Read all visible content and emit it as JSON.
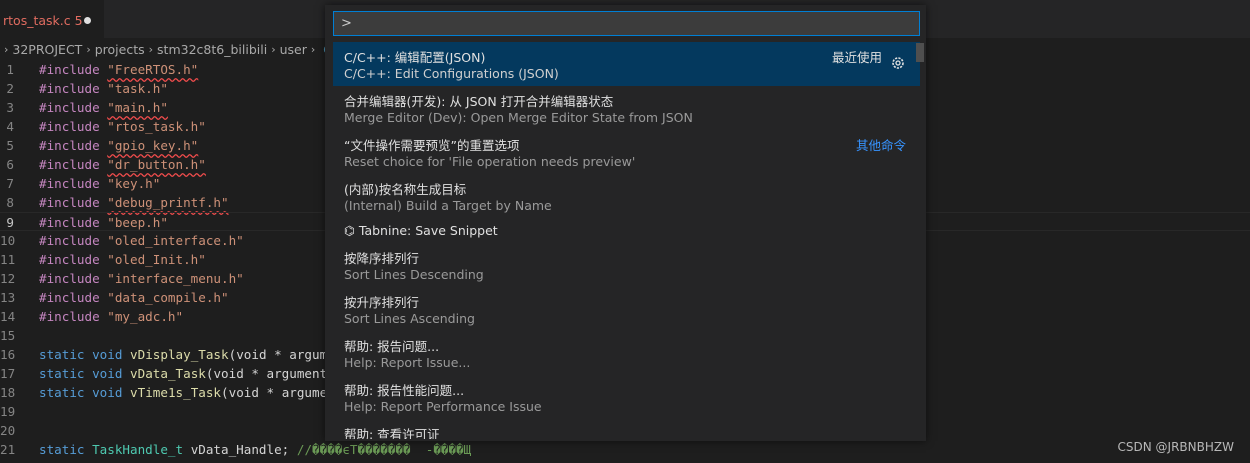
{
  "tab": {
    "filename": "rtos_task.c",
    "problems": "5"
  },
  "breadcrumb": {
    "items": [
      "32PROJECT",
      "projects",
      "stm32c8t6_bilibili",
      "user"
    ],
    "last": "C"
  },
  "editor": {
    "lines": [
      {
        "n": "1",
        "kw": "#include",
        "str": "\"FreeRTOS.h\"",
        "err": true
      },
      {
        "n": "2",
        "kw": "#include",
        "str": "\"task.h\"",
        "err": false
      },
      {
        "n": "3",
        "kw": "#include",
        "str": "\"main.h\"",
        "err": true
      },
      {
        "n": "4",
        "kw": "#include",
        "str": "\"rtos_task.h\"",
        "err": false
      },
      {
        "n": "5",
        "kw": "#include",
        "str": "\"gpio_key.h\"",
        "err": true
      },
      {
        "n": "6",
        "kw": "#include",
        "str": "\"dr_button.h\"",
        "err": true
      },
      {
        "n": "7",
        "kw": "#include",
        "str": "\"key.h\"",
        "err": false
      },
      {
        "n": "8",
        "kw": "#include",
        "str": "\"debug_printf.h\"",
        "err": true
      },
      {
        "n": "9",
        "kw": "#include",
        "str": "\"beep.h\"",
        "err": false
      },
      {
        "n": "10",
        "kw": "#include",
        "str": "\"oled_interface.h\"",
        "err": false
      },
      {
        "n": "11",
        "kw": "#include",
        "str": "\"oled_Init.h\"",
        "err": false
      },
      {
        "n": "12",
        "kw": "#include",
        "str": "\"interface_menu.h\"",
        "err": false
      },
      {
        "n": "13",
        "kw": "#include",
        "str": "\"data_compile.h\"",
        "err": false
      },
      {
        "n": "14",
        "kw": "#include",
        "str": "\"my_adc.h\"",
        "err": false
      }
    ],
    "line15": "15",
    "decls": [
      {
        "n": "16",
        "fn": "vDisplay_Task",
        "tail": "(void * argum"
      },
      {
        "n": "17",
        "fn": "vData_Task",
        "tail": "(void * argument"
      },
      {
        "n": "18",
        "fn": "vTime1s_Task",
        "tail": "(void * argume"
      }
    ],
    "line19": "19",
    "line20": "20",
    "line21": {
      "n": "21",
      "type": "TaskHandle_t",
      "var": "vData_Handle;",
      "comment": "//����ϵT�������  -����Щ"
    },
    "static_kw": "static",
    "void_kw": "void"
  },
  "palette": {
    "input_value": ">",
    "items": [
      {
        "primary": "C/C++: 编辑配置(JSON)",
        "secondary": "C/C++: Edit Configurations (JSON)",
        "right": "最近使用",
        "active": true
      },
      {
        "primary": "合并编辑器(开发): 从 JSON 打开合并编辑器状态",
        "secondary": "Merge Editor (Dev): Open Merge Editor State from JSON",
        "right": "",
        "active": false
      },
      {
        "primary": "“文件操作需要预览”的重置选项",
        "secondary": "Reset choice for 'File operation needs preview'",
        "right": "其他命令",
        "active": false
      },
      {
        "primary": "(内部)按名称生成目标",
        "secondary": "(Internal) Build a Target by Name",
        "right": "",
        "active": false
      },
      {
        "primary": "⌬ Tabnine: Save Snippet",
        "secondary": "",
        "right": "",
        "active": false
      },
      {
        "primary": "按降序排列行",
        "secondary": "Sort Lines Descending",
        "right": "",
        "active": false
      },
      {
        "primary": "按升序排列行",
        "secondary": "Sort Lines Ascending",
        "right": "",
        "active": false
      },
      {
        "primary": "帮助: 报告问题...",
        "secondary": "Help: Report Issue...",
        "right": "",
        "active": false
      },
      {
        "primary": "帮助: 报告性能问题...",
        "secondary": "Help: Report Performance Issue",
        "right": "",
        "active": false
      },
      {
        "primary": "帮助: 查看许可证",
        "secondary": "",
        "right": "",
        "active": false
      }
    ]
  },
  "watermark": "CSDN @JRBNBHZW"
}
